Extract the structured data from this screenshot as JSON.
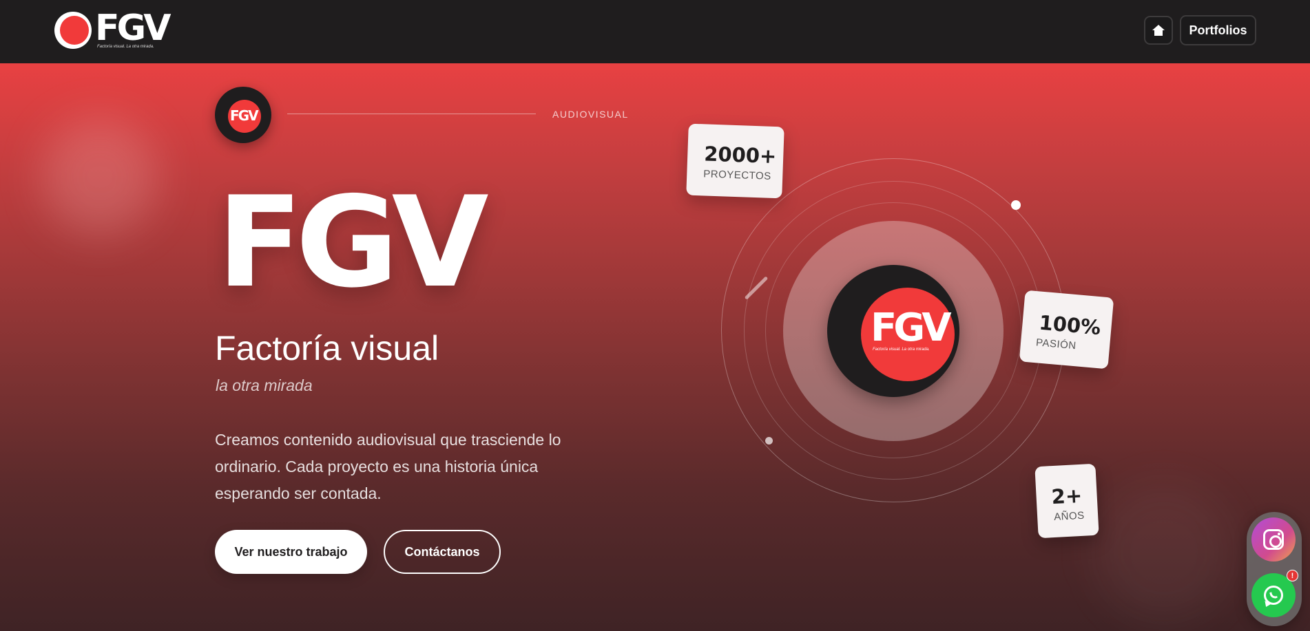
{
  "header": {
    "logo_text": "FGV",
    "logo_tagline": "Factoría visual. La otra mirada.",
    "home_icon": "home-icon",
    "portfolios_label": "Portfolios"
  },
  "hero": {
    "badge_logo_text": "FGV",
    "section_label": "AUDIOVISUAL",
    "title": "FGV",
    "subtitle": "Factoría visual",
    "tagline": "la otra mirada",
    "description": "Creamos contenido audiovisual que trasciende lo ordinario. Cada proyecto es una historia única esperando ser contada.",
    "primary_button": "Ver nuestro trabajo",
    "secondary_button": "Contáctanos"
  },
  "visual": {
    "center_logo_text": "FGV",
    "center_logo_tagline": "Factoría visual. La otra mirada.",
    "stats": [
      {
        "value": "2000+",
        "label": "PROYECTOS"
      },
      {
        "value": "100%",
        "label": "PASIÓN"
      },
      {
        "value": "2+",
        "label": "AÑOS"
      }
    ]
  },
  "social": {
    "instagram_icon": "instagram-icon",
    "whatsapp_icon": "whatsapp-icon",
    "notification_badge": "!"
  },
  "colors": {
    "brand_red": "#f13a3a",
    "dark": "#1f1d1e",
    "whatsapp_green": "#25c94f"
  }
}
